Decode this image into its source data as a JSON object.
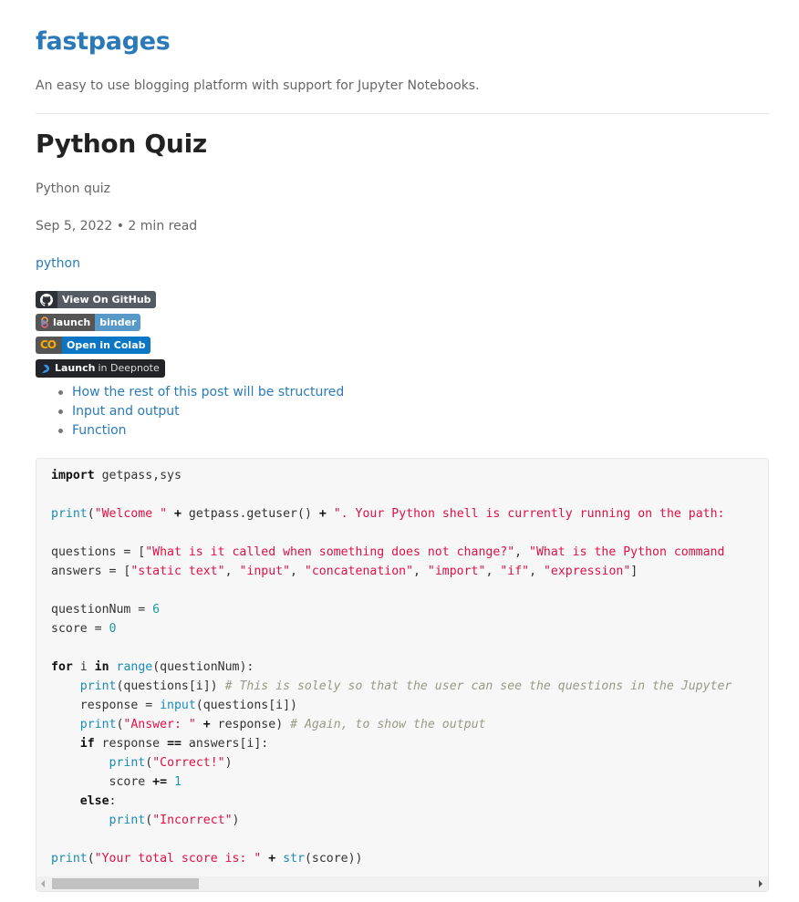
{
  "site": {
    "title": "fastpages",
    "description": "An easy to use blogging platform with support for Jupyter Notebooks."
  },
  "post": {
    "title": "Python Quiz",
    "description": "Python quiz",
    "meta": "Sep 5, 2022 • 2 min read",
    "tag": "python"
  },
  "badges": {
    "github": {
      "label": "View On GitHub",
      "icon": "github-icon"
    },
    "binder": {
      "left": "launch",
      "right": "binder",
      "icon": "binder-icon"
    },
    "colab": {
      "left": "CO",
      "right": "Open in Colab",
      "icon": "colab-icon"
    },
    "deepnote": {
      "strong": "Launch",
      "soft": "in Deepnote",
      "icon": "deepnote-icon"
    }
  },
  "toc": [
    {
      "label": "How the rest of this post will be structured"
    },
    {
      "label": "Input and output"
    },
    {
      "label": "Function"
    }
  ],
  "code": {
    "language": "python",
    "lines": [
      "import getpass,sys",
      "",
      "print(\"Welcome \" + getpass.getuser() + \". Your Python shell is currently running on the path:",
      "",
      "questions = [\"What is it called when something does not change?\", \"What is the Python command",
      "answers = [\"static text\", \"input\", \"concatenation\", \"import\", \"if\", \"expression\"]",
      "",
      "questionNum = 6",
      "score = 0",
      "",
      "for i in range(questionNum):",
      "    print(questions[i]) # This is solely so that the user can see the questions in the Jupyter",
      "    response = input(questions[i])",
      "    print(\"Answer: \" + response) # Again, to show the output",
      "    if response == answers[i]:",
      "        print(\"Correct!\")",
      "        score += 1",
      "    else:",
      "        print(\"Incorrect\")",
      "",
      "print(\"Your total score is: \" + str(score))"
    ]
  },
  "colors": {
    "link": "#2a7ab9",
    "keyword": "#111111",
    "builtin": "#1b8bb5",
    "string": "#dd1144",
    "number": "#1a9aa0",
    "comment": "#999988",
    "code_bg": "#f7f7f7"
  }
}
